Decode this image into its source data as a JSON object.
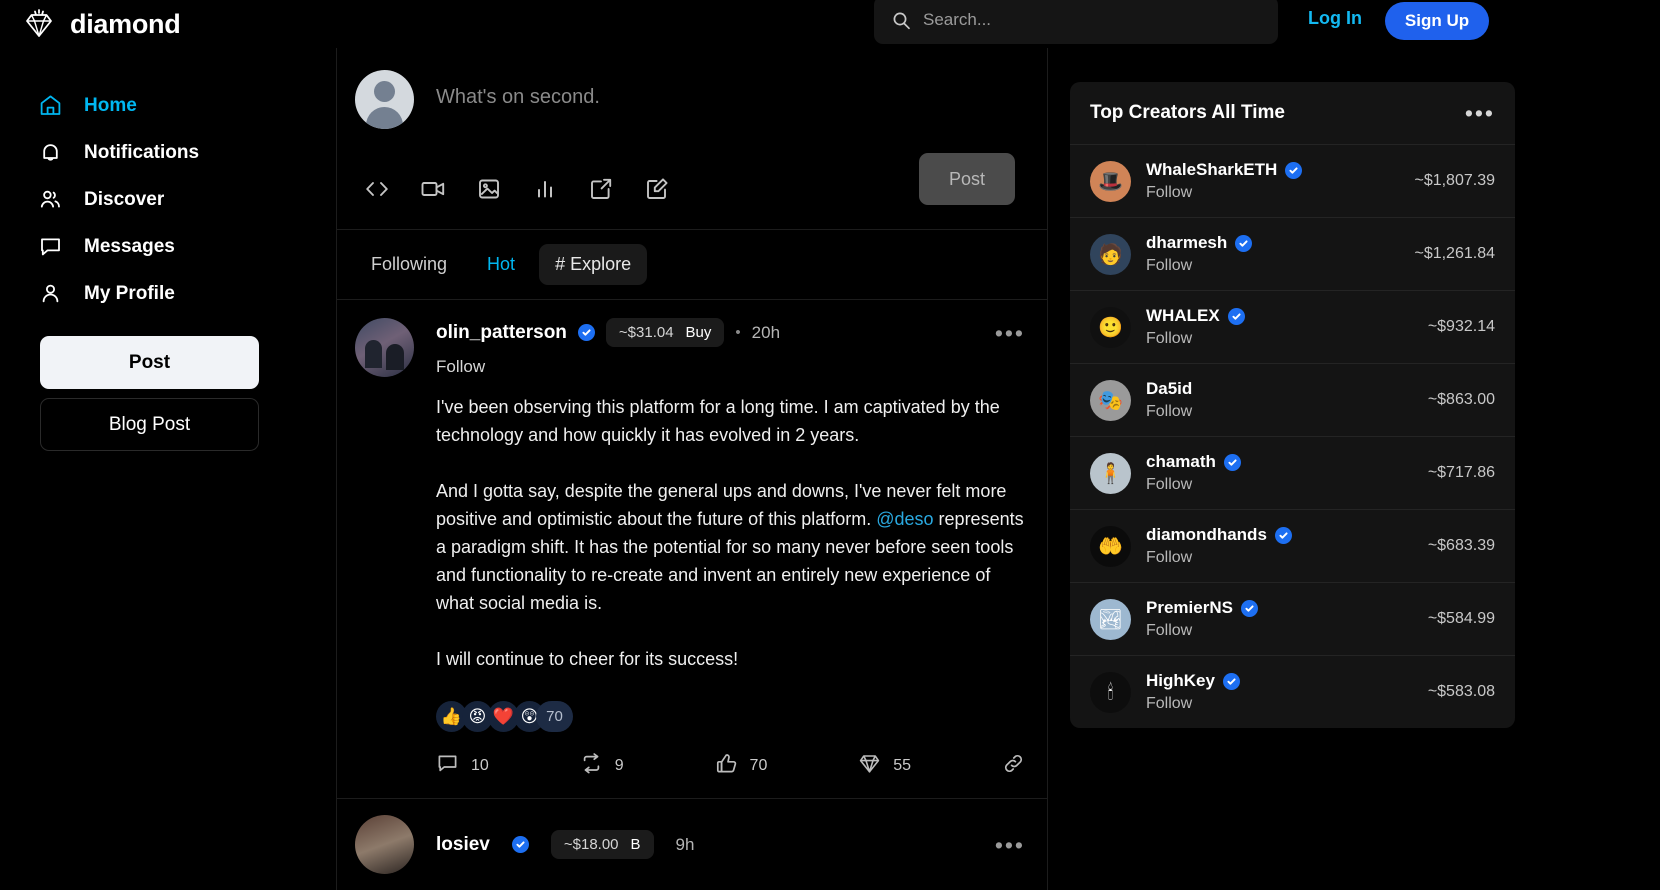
{
  "header": {
    "brand": "diamond",
    "logo_icon": "diamond-icon",
    "search": {
      "icon": "search-icon",
      "value": "",
      "placeholder": "Search..."
    },
    "login_label": "Log In",
    "signup_label": "Sign Up"
  },
  "sidebar": {
    "items": [
      {
        "label": "Home",
        "icon": "home-icon",
        "active": true
      },
      {
        "label": "Notifications",
        "icon": "bell-icon",
        "active": false
      },
      {
        "label": "Discover",
        "icon": "people-icon",
        "active": false
      },
      {
        "label": "Messages",
        "icon": "chat-bubble-icon",
        "active": false
      },
      {
        "label": "My Profile",
        "icon": "person-icon",
        "active": false
      }
    ],
    "post_label": "Post",
    "blog_post_label": "Blog Post"
  },
  "composer": {
    "placeholder": "What's on second.",
    "avatar_icon": "default-avatar-icon",
    "post_label": "Post",
    "tools": [
      {
        "name": "code-icon"
      },
      {
        "name": "video-icon"
      },
      {
        "name": "image-icon"
      },
      {
        "name": "poll-chart-icon"
      },
      {
        "name": "external-link-icon"
      },
      {
        "name": "compose-icon"
      }
    ]
  },
  "tabs": [
    {
      "label": "Following",
      "state": "inactive"
    },
    {
      "label": "Hot",
      "state": "active"
    },
    {
      "label": "# Explore",
      "state": "boxed"
    }
  ],
  "post": {
    "username": "olin_patterson",
    "verified": true,
    "price": "~$31.04",
    "buy_label": "Buy",
    "separator": "•",
    "time": "20h",
    "more_icon": "ellipsis-icon",
    "follow_label": "Follow",
    "paragraphs": [
      "I've been observing this platform for a long time. I am captivated by the technology and how quickly it has evolved in 2 years.",
      "And I gotta say, despite the general ups and downs, I've never felt more positive and optimistic about the future of this platform. @deso represents a paradigm shift. It has the potential for so many never before seen tools and functionality to re-create and invent an entirely new experience of what social media is.",
      "I will continue to cheer for its success!"
    ],
    "mention": "@deso",
    "reactions": {
      "emojis": [
        "👍",
        "😡",
        "❤️",
        "😲"
      ],
      "count": "70"
    },
    "actions": [
      {
        "icon": "comment-icon",
        "count": "10"
      },
      {
        "icon": "repost-icon",
        "count": "9"
      },
      {
        "icon": "thumbs-up-icon",
        "count": "70"
      },
      {
        "icon": "diamond-icon",
        "count": "55"
      },
      {
        "icon": "link-icon",
        "count": ""
      }
    ]
  },
  "next_post": {
    "username": "losiev",
    "verified": true,
    "price": "~$18.00",
    "buy_label": "B",
    "time": "9h",
    "more_icon": "ellipsis-icon"
  },
  "creators_panel": {
    "title": "Top Creators All Time",
    "more_icon": "ellipsis-icon",
    "follow_label": "Follow",
    "items": [
      {
        "name": "WhaleSharkETH",
        "verified": true,
        "value": "~$1,807.39",
        "avatar_glyph": "🎩",
        "avatar_bg": "#d08457"
      },
      {
        "name": "dharmesh",
        "verified": true,
        "value": "~$1,261.84",
        "avatar_glyph": "🧑",
        "avatar_bg": "#30445c"
      },
      {
        "name": "WHALEX",
        "verified": true,
        "value": "~$932.14",
        "avatar_glyph": "🙂",
        "avatar_bg": "#111111"
      },
      {
        "name": "Da5id",
        "verified": false,
        "value": "~$863.00",
        "avatar_glyph": "🎭",
        "avatar_bg": "#8a8a8a"
      },
      {
        "name": "chamath",
        "verified": true,
        "value": "~$717.86",
        "avatar_glyph": "🧍",
        "avatar_bg": "#b9c4cc"
      },
      {
        "name": "diamondhands",
        "verified": true,
        "value": "~$683.39",
        "avatar_glyph": "🤲",
        "avatar_bg": "#0b0b0b"
      },
      {
        "name": "PremierNS",
        "verified": true,
        "value": "~$584.99",
        "avatar_glyph": "🏞",
        "avatar_bg": "#9db8d0"
      },
      {
        "name": "HighKey",
        "verified": true,
        "value": "~$583.08",
        "avatar_glyph": "🕯",
        "avatar_bg": "#0d0d0d"
      }
    ]
  },
  "colors": {
    "accent_cyan": "#00b7f1",
    "accent_blue": "#1f61ed",
    "verified_blue": "#1d6ff2",
    "background": "#000000",
    "card": "#141414"
  }
}
